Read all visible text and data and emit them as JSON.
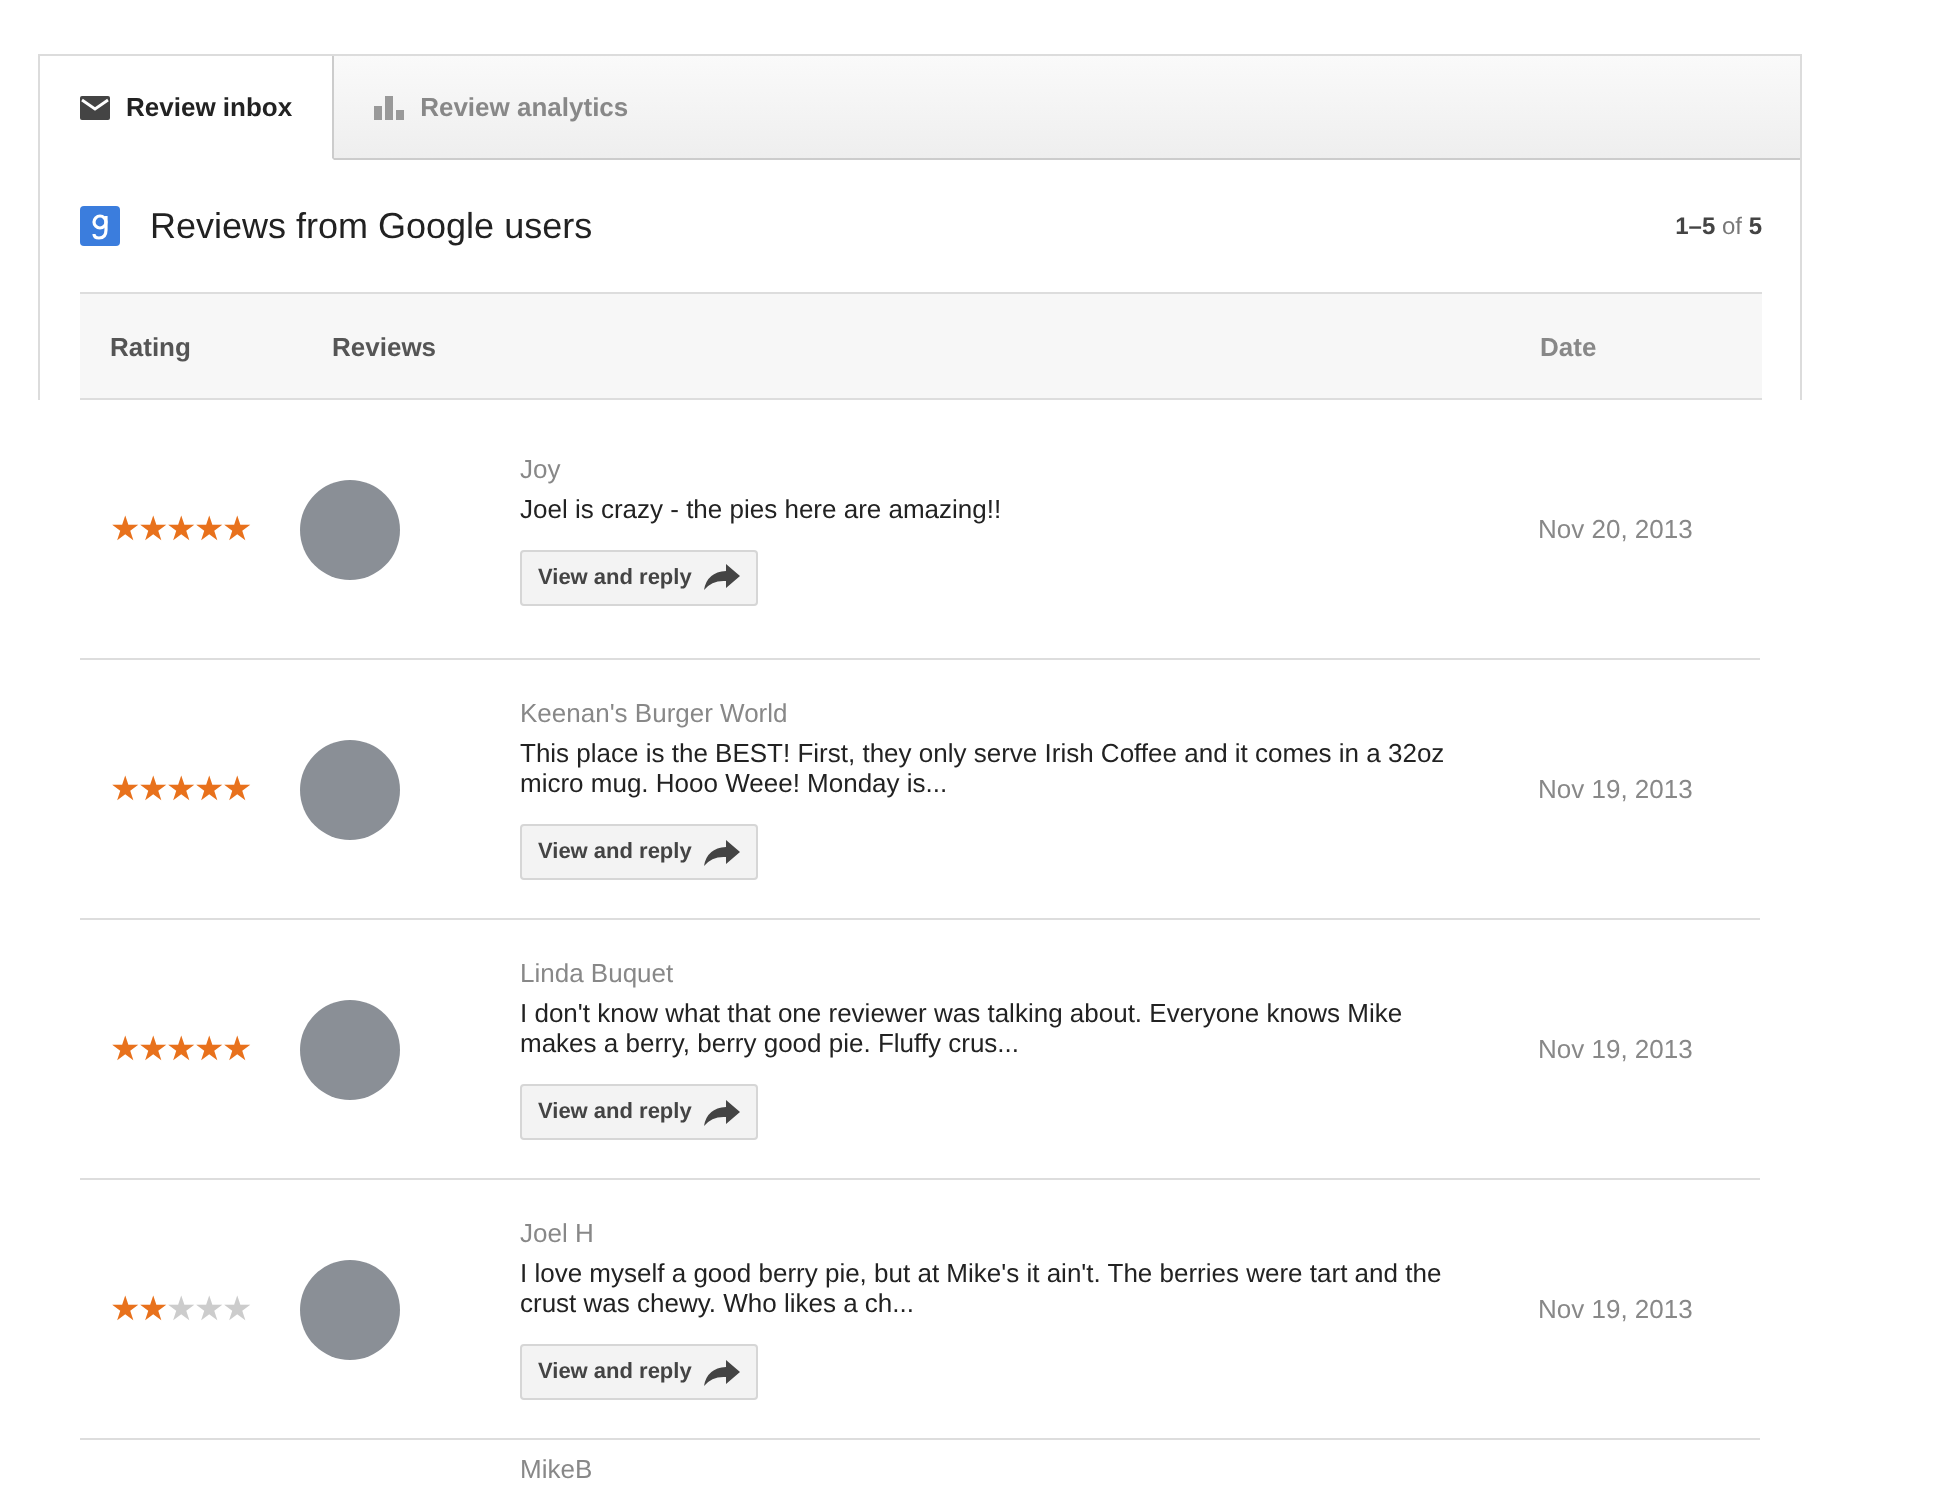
{
  "tabs": [
    {
      "label": "Review inbox",
      "kind": "inbox",
      "selected": true
    },
    {
      "label": "Review analytics",
      "kind": "analytics",
      "selected": false
    }
  ],
  "header": {
    "title": "Reviews from Google users",
    "range": "1–5",
    "of": "of",
    "total": "5"
  },
  "table": {
    "columns": [
      "Rating",
      "Reviews",
      "Date"
    ],
    "rows": [
      {
        "stars": 5,
        "name": "Joy",
        "text": "Joel is crazy - the pies here are amazing!!",
        "button": "View and reply",
        "date": "Nov 20, 2013"
      },
      {
        "stars": 5,
        "name": "Keenan's Burger World",
        "text": "This place is the BEST! First, they only serve Irish Coffee and it comes in a 32oz micro mug. Hooo Weee! Monday is...",
        "button": "View and reply",
        "date": "Nov 19, 2013"
      },
      {
        "stars": 5,
        "name": "Linda Buquet",
        "text": "I don't know what that one reviewer was talking about. Everyone knows Mike makes a berry, berry good pie. Fluffy crus...",
        "button": "View and reply",
        "date": "Nov 19, 2013"
      },
      {
        "stars": 2,
        "name": "Joel H",
        "text": "I love myself a good berry pie, but at Mike's it ain't. The berries were tart and the crust was chewy. Who likes a ch...",
        "button": "View and reply",
        "date": "Nov 19, 2013"
      },
      {
        "name": "MikeB"
      }
    ]
  }
}
